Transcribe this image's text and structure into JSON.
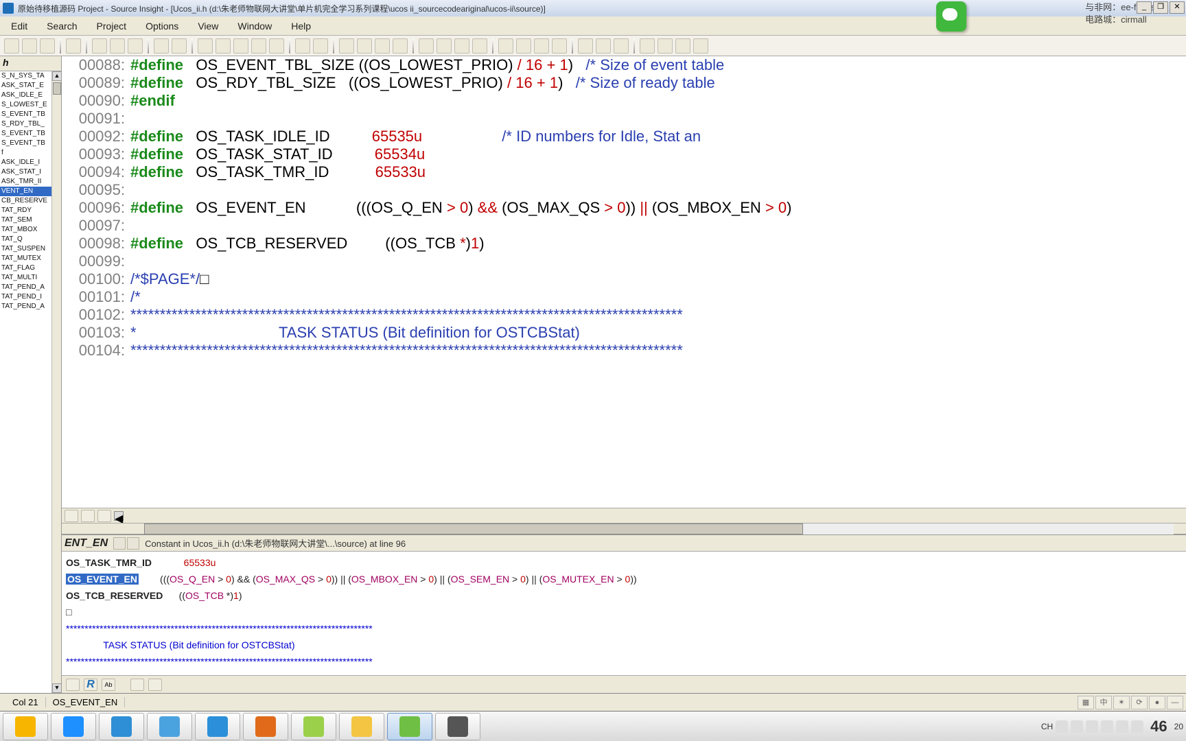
{
  "title": "原始待移植源码 Project - Source Insight - [Ucos_ii.h (d:\\朱老师物联网大讲堂\\单片机完全学习系列课程\\ucos ii_sourcecodeariginal\\ucos-ii\\source)]",
  "wechat_popup": {
    "line1": "与非网：ee-focus",
    "line2": "电路城：cirmall"
  },
  "menu": [
    "Edit",
    "Search",
    "Project",
    "Options",
    "View",
    "Window",
    "Help"
  ],
  "sidebar": {
    "header": "h",
    "items": [
      "S_N_SYS_TA",
      "ASK_STAT_E",
      "ASK_IDLE_E",
      "S_LOWEST_E",
      "S_EVENT_TB",
      "S_RDY_TBL_",
      "S_EVENT_TB",
      "S_EVENT_TB",
      "f",
      "ASK_IDLE_I",
      "ASK_STAT_I",
      "ASK_TMR_II",
      "VENT_EN",
      "CB_RESERVE",
      "TAT_RDY",
      "TAT_SEM",
      "TAT_MBOX",
      "TAT_Q",
      "TAT_SUSPEN",
      "TAT_MUTEX",
      "TAT_FLAG",
      "TAT_MULTI",
      "TAT_PEND_A",
      "TAT_PEND_I",
      "TAT_PEND_A"
    ],
    "selected_index": 12
  },
  "code_lines": [
    {
      "n": "00088",
      "seg": [
        [
          "kw",
          "#define"
        ],
        [
          "sp",
          "   "
        ],
        [
          "ident",
          "OS_EVENT_TBL_SIZE"
        ],
        [
          "sp",
          " "
        ],
        [
          "paren",
          "(("
        ],
        [
          "ident",
          "OS_LOWEST_PRIO"
        ],
        [
          "paren",
          ")"
        ],
        [
          "sp",
          " "
        ],
        [
          "op",
          "/"
        ],
        [
          "sp",
          " "
        ],
        [
          "num",
          "16"
        ],
        [
          "sp",
          " "
        ],
        [
          "op",
          "+"
        ],
        [
          "sp",
          " "
        ],
        [
          "num",
          "1"
        ],
        [
          "paren",
          ")"
        ],
        [
          "sp",
          "   "
        ],
        [
          "cmt",
          "/* Size of event table"
        ]
      ]
    },
    {
      "n": "00089",
      "seg": [
        [
          "kw",
          "#define"
        ],
        [
          "sp",
          "   "
        ],
        [
          "ident",
          "OS_RDY_TBL_SIZE"
        ],
        [
          "sp",
          "   "
        ],
        [
          "paren",
          "(("
        ],
        [
          "ident",
          "OS_LOWEST_PRIO"
        ],
        [
          "paren",
          ")"
        ],
        [
          "sp",
          " "
        ],
        [
          "op",
          "/"
        ],
        [
          "sp",
          " "
        ],
        [
          "num",
          "16"
        ],
        [
          "sp",
          " "
        ],
        [
          "op",
          "+"
        ],
        [
          "sp",
          " "
        ],
        [
          "num",
          "1"
        ],
        [
          "paren",
          ")"
        ],
        [
          "sp",
          "   "
        ],
        [
          "cmt",
          "/* Size of ready table"
        ]
      ]
    },
    {
      "n": "00090",
      "seg": [
        [
          "kw",
          "#endif"
        ]
      ]
    },
    {
      "n": "00091",
      "seg": []
    },
    {
      "n": "00092",
      "seg": [
        [
          "kw",
          "#define"
        ],
        [
          "sp",
          "   "
        ],
        [
          "ident",
          "OS_TASK_IDLE_ID"
        ],
        [
          "sp",
          "          "
        ],
        [
          "num",
          "65535u"
        ],
        [
          "sp",
          "                   "
        ],
        [
          "cmt",
          "/* ID numbers for Idle, Stat an"
        ]
      ]
    },
    {
      "n": "00093",
      "seg": [
        [
          "kw",
          "#define"
        ],
        [
          "sp",
          "   "
        ],
        [
          "ident",
          "OS_TASK_STAT_ID"
        ],
        [
          "sp",
          "          "
        ],
        [
          "num",
          "65534u"
        ]
      ]
    },
    {
      "n": "00094",
      "seg": [
        [
          "kw",
          "#define"
        ],
        [
          "sp",
          "   "
        ],
        [
          "ident",
          "OS_TASK_TMR_ID"
        ],
        [
          "sp",
          "           "
        ],
        [
          "num",
          "65533u"
        ]
      ]
    },
    {
      "n": "00095",
      "seg": []
    },
    {
      "n": "00096",
      "seg": [
        [
          "kw",
          "#define"
        ],
        [
          "sp",
          "   "
        ],
        [
          "ident",
          "OS_EVENT_EN"
        ],
        [
          "sp",
          "            "
        ],
        [
          "paren",
          "((("
        ],
        [
          "ident",
          "OS_Q_EN"
        ],
        [
          "sp",
          " "
        ],
        [
          "op",
          ">"
        ],
        [
          "sp",
          " "
        ],
        [
          "num",
          "0"
        ],
        [
          "paren",
          ")"
        ],
        [
          "sp",
          " "
        ],
        [
          "op",
          "&&"
        ],
        [
          "sp",
          " "
        ],
        [
          "paren",
          "("
        ],
        [
          "ident",
          "OS_MAX_QS"
        ],
        [
          "sp",
          " "
        ],
        [
          "op",
          ">"
        ],
        [
          "sp",
          " "
        ],
        [
          "num",
          "0"
        ],
        [
          "paren",
          "))"
        ],
        [
          "sp",
          " "
        ],
        [
          "op",
          "||"
        ],
        [
          "sp",
          " "
        ],
        [
          "paren",
          "("
        ],
        [
          "ident",
          "OS_MBOX_EN"
        ],
        [
          "sp",
          " "
        ],
        [
          "op",
          ">"
        ],
        [
          "sp",
          " "
        ],
        [
          "num",
          "0"
        ],
        [
          "paren",
          ")"
        ]
      ]
    },
    {
      "n": "00097",
      "seg": []
    },
    {
      "n": "00098",
      "seg": [
        [
          "kw",
          "#define"
        ],
        [
          "sp",
          "   "
        ],
        [
          "ident",
          "OS_TCB_RESERVED"
        ],
        [
          "sp",
          "         "
        ],
        [
          "paren",
          "(("
        ],
        [
          "ident",
          "OS_TCB"
        ],
        [
          "sp",
          " "
        ],
        [
          "op",
          "*"
        ],
        [
          "paren",
          ")"
        ],
        [
          "num",
          "1"
        ],
        [
          "paren",
          ")"
        ]
      ]
    },
    {
      "n": "00099",
      "seg": []
    },
    {
      "n": "00100",
      "seg": [
        [
          "cmt",
          "/*$PAGE*/"
        ],
        [
          "ident",
          "□"
        ]
      ]
    },
    {
      "n": "00101",
      "seg": [
        [
          "cmt",
          "/*"
        ]
      ]
    },
    {
      "n": "00102",
      "seg": [
        [
          "cmt",
          "**********************************************************************************************"
        ]
      ]
    },
    {
      "n": "00103",
      "seg": [
        [
          "cmt",
          "*                                  TASK STATUS (Bit definition for OSTCBStat)"
        ]
      ]
    },
    {
      "n": "00104",
      "seg": [
        [
          "cmt",
          "**********************************************************************************************"
        ]
      ]
    }
  ],
  "ref": {
    "name": "ENT_EN",
    "desc": "Constant in Ucos_ii.h (d:\\朱老师物联网大讲堂\\...\\source) at line 96",
    "lines": [
      {
        "label": "OS_TASK_TMR_ID",
        "rest": "            65533u"
      },
      {
        "label": "OS_EVENT_EN",
        "highlight": true,
        "rest": "        (((OS_Q_EN > 0) && (OS_MAX_QS > 0)) || (OS_MBOX_EN > 0) || (OS_SEM_EN > 0) || (OS_MUTEX_EN > 0))"
      },
      {
        "label": "OS_TCB_RESERVED",
        "rest": "      ((OS_TCB *)1)"
      },
      {
        "label": "□",
        "rest": ""
      },
      {
        "label": "",
        "comment": "**********************************************************************************"
      },
      {
        "label": "",
        "comment": "              TASK STATUS (Bit definition for OSTCBStat)"
      },
      {
        "label": "",
        "comment": "**********************************************************************************"
      }
    ]
  },
  "status": {
    "col": "Col 21",
    "sym": "OS_EVENT_EN"
  },
  "tray": {
    "ime": "CH",
    "kb": "⌨",
    "clock": "46",
    "date_suffix": "20"
  },
  "taskbar_icons": [
    "start",
    "cloud",
    "ie",
    "globe",
    "pencil",
    "foxit",
    "notepad",
    "explorer",
    "camtasia-rec",
    "camtasia-lib"
  ]
}
